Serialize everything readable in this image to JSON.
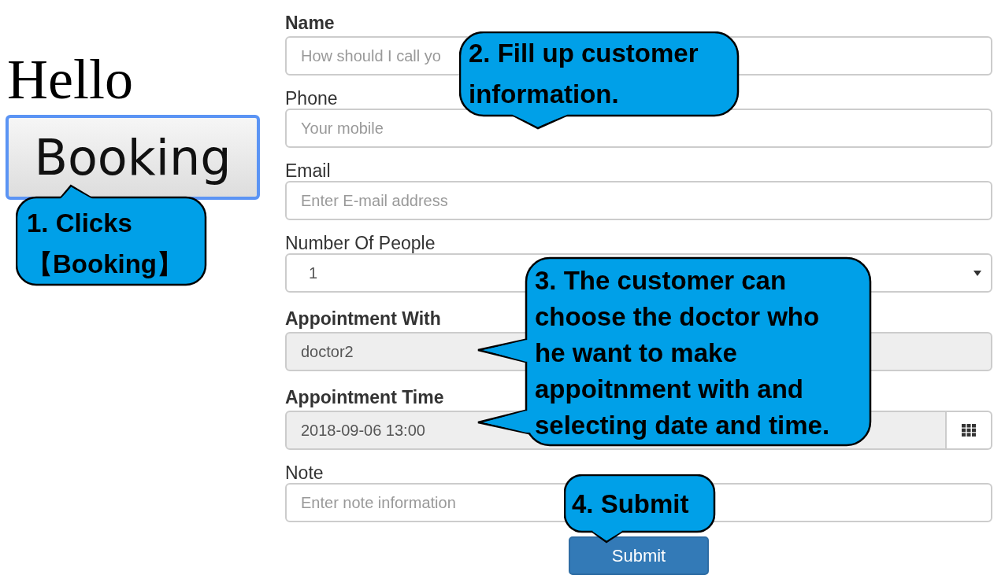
{
  "greeting": "Hello",
  "booking_button": "Booking",
  "form": {
    "fields": [
      {
        "kind": "text",
        "label": "Name",
        "bold": true,
        "placeholder": "How should I call yo"
      },
      {
        "kind": "text",
        "label": "Phone",
        "bold": false,
        "placeholder": "Your mobile"
      },
      {
        "kind": "text",
        "label": "Email",
        "bold": false,
        "placeholder": "Enter E-mail address"
      },
      {
        "kind": "select",
        "label": "Number Of People",
        "bold": false,
        "value": "1"
      },
      {
        "kind": "readonly",
        "label": "Appointment With",
        "bold": true,
        "value": "doctor2"
      },
      {
        "kind": "datetime",
        "label": "Appointment Time",
        "bold": true,
        "value": "2018-09-06 13:00"
      },
      {
        "kind": "text",
        "label": "Note",
        "bold": false,
        "placeholder": "Enter note information"
      }
    ],
    "submit": "Submit"
  },
  "callouts": [
    {
      "text": "1. Clicks 【Booking】"
    },
    {
      "text": "2. Fill up customer information."
    },
    {
      "text": "3. The customer can choose the doctor who he want to make appoitnment with and selecting date and time."
    },
    {
      "text": "4. Submit"
    }
  ]
}
